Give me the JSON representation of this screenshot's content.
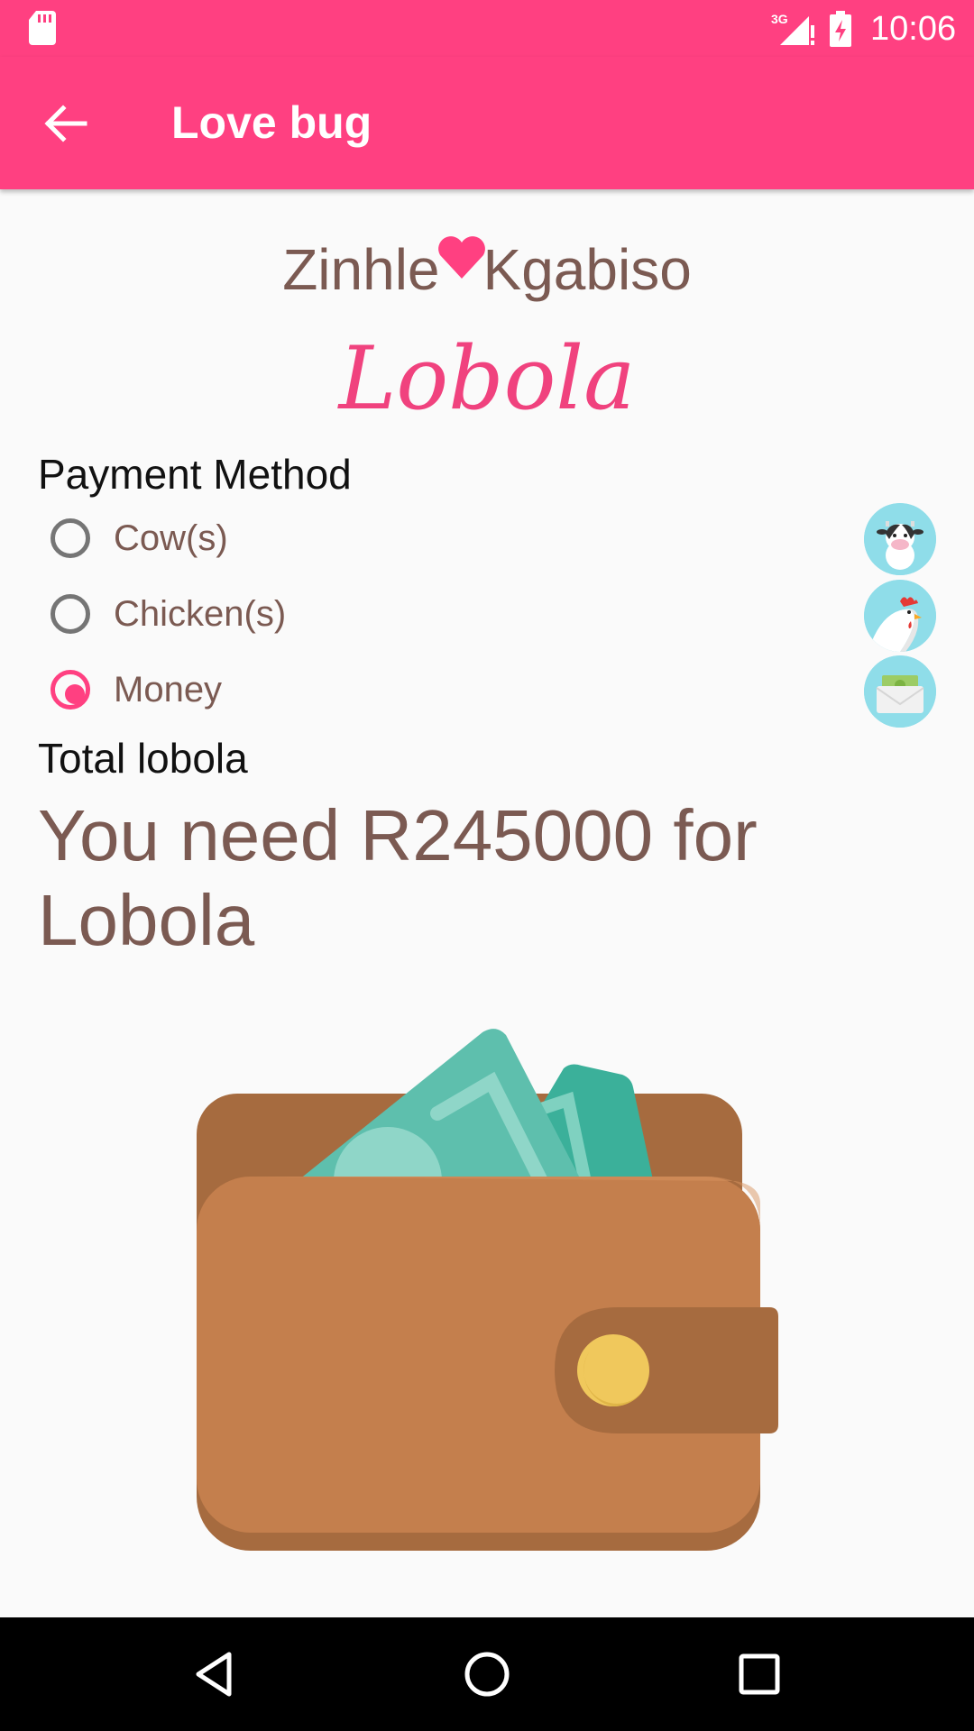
{
  "status_bar": {
    "time": "10:06",
    "network": "3G",
    "icons": [
      "sd-card-icon",
      "signal-icon",
      "battery-charging-icon"
    ]
  },
  "app_bar": {
    "title": "Love bug",
    "back_icon": "arrow-left-icon"
  },
  "couple": {
    "name_one": "Zinhle",
    "name_two": "Kgabiso",
    "heart_icon": "heart-icon"
  },
  "heading": "Lobola",
  "payment": {
    "label": "Payment Method",
    "options": [
      {
        "label": "Cow(s)",
        "checked": false,
        "icon": "cow-icon"
      },
      {
        "label": "Chicken(s)",
        "checked": false,
        "icon": "chicken-icon"
      },
      {
        "label": "Money",
        "checked": true,
        "icon": "money-envelope-icon"
      }
    ]
  },
  "total": {
    "label": "Total lobola",
    "message": "You need R245000  for Lobola"
  },
  "illustration": "wallet-icon",
  "nav": {
    "icons": [
      "back-triangle-icon",
      "home-circle-icon",
      "recents-square-icon"
    ]
  },
  "colors": {
    "accent": "#ff4081",
    "text_brown": "#7b5a52",
    "icon_bg": "#8fdde9"
  }
}
